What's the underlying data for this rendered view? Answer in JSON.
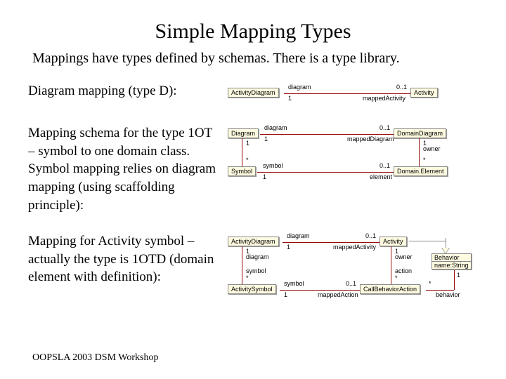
{
  "title": "Simple Mapping Types",
  "subtitle": "Mappings have types defined by schemas. There is a type library.",
  "rows": [
    {
      "label": "Diagram mapping (type D):"
    },
    {
      "label": "Mapping schema for  the type 1OT – symbol to one domain class. Symbol mapping relies on diagram mapping (using scaffolding principle):"
    },
    {
      "label": "Mapping for Activity symbol – actually the type is 1OTD (domain element with definition):"
    }
  ],
  "footer": "OOPSLA 2003 DSM Workshop",
  "uml1": {
    "left_class": "ActivityDiagram",
    "right_class": "Activity",
    "assoc_left": "diagram",
    "assoc_right": "mappedActivity",
    "mult_left": "1",
    "mult_right": "0..1"
  },
  "uml2": {
    "tl": "Diagram",
    "tr": "DomainDiagram",
    "bl": "Symbol",
    "br": "Domain.Element",
    "top_al": "diagram",
    "top_ar": "mappedDiagram",
    "bot_al": "symbol",
    "bot_ar": "element",
    "m1": "1",
    "m01": "0..1",
    "mstar": "*",
    "owner": "owner",
    "diagram": "diagram"
  },
  "uml3": {
    "tl": "ActivityDiagram",
    "tr": "Activity",
    "bl": "ActivitySymbol",
    "br": "CallBehaviorAction",
    "attr_name": "Behavior",
    "attr_prop": "name:String",
    "top_al": "diagram",
    "top_ar": "mappedActivity",
    "bot_al": "symbol",
    "bot_ar": "mappedAction",
    "m1": "1",
    "m01": "0..1",
    "mstar": "*",
    "owner": "owner",
    "diagram": "diagram",
    "symbol": "symbol",
    "action": "action",
    "behavior": "behavior"
  }
}
